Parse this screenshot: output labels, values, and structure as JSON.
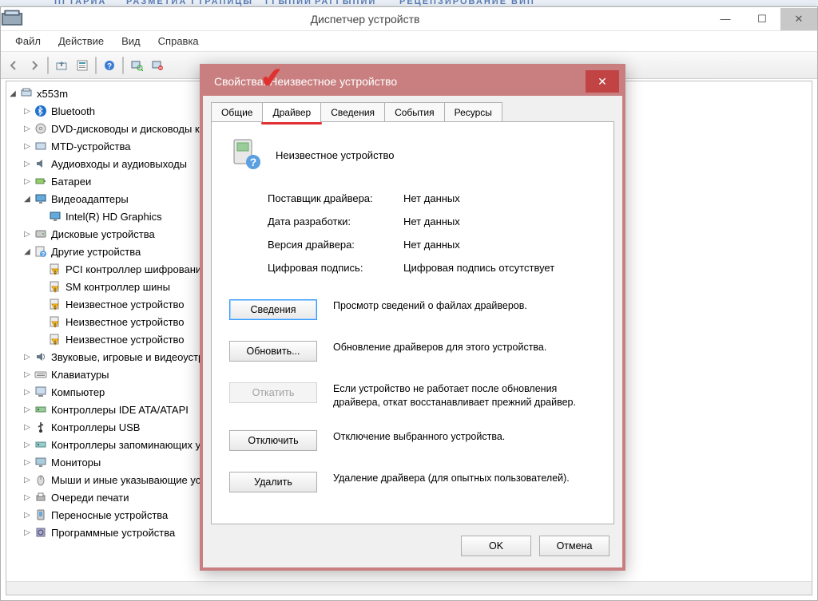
{
  "bg_labels": {
    "l1": "ПГТАРИА",
    "l2": "РАЗМЕТИА ГТРАПИЦЫ",
    "l3": "ГГЫПИИ",
    "l4": "РАГГЫПИИ",
    "l5": "РЕЦЕПЗИРОВАНИЕ",
    "l6": "ВИП"
  },
  "window": {
    "title": "Диспетчер устройств",
    "menu": {
      "file": "Файл",
      "action": "Действие",
      "view": "Вид",
      "help": "Справка"
    }
  },
  "tree": {
    "root": "x553m",
    "items": [
      {
        "label": "Bluetooth",
        "depth": 1,
        "exp": "closed",
        "icon": "bt"
      },
      {
        "label": "DVD-дисководы и дисководы компакт-дисков",
        "depth": 1,
        "exp": "closed",
        "icon": "dvd"
      },
      {
        "label": "MTD-устройства",
        "depth": 1,
        "exp": "closed",
        "icon": "mtd"
      },
      {
        "label": "Аудиовходы и аудиовыходы",
        "depth": 1,
        "exp": "closed",
        "icon": "audio"
      },
      {
        "label": "Батареи",
        "depth": 1,
        "exp": "closed",
        "icon": "bat"
      },
      {
        "label": "Видеоадаптеры",
        "depth": 1,
        "exp": "open",
        "icon": "disp"
      },
      {
        "label": "Intel(R) HD Graphics",
        "depth": 2,
        "exp": "none",
        "icon": "disp"
      },
      {
        "label": "Дисковые устройства",
        "depth": 1,
        "exp": "closed",
        "icon": "disk"
      },
      {
        "label": "Другие устройства",
        "depth": 1,
        "exp": "open",
        "icon": "other"
      },
      {
        "label": "PCI контроллер шифрования/расшифрования",
        "depth": 2,
        "exp": "none",
        "icon": "warn"
      },
      {
        "label": "SM контроллер шины",
        "depth": 2,
        "exp": "none",
        "icon": "warn"
      },
      {
        "label": "Неизвестное устройство",
        "depth": 2,
        "exp": "none",
        "icon": "warn"
      },
      {
        "label": "Неизвестное устройство",
        "depth": 2,
        "exp": "none",
        "icon": "warn"
      },
      {
        "label": "Неизвестное устройство",
        "depth": 2,
        "exp": "none",
        "icon": "warn"
      },
      {
        "label": "Звуковые, игровые и видеоустройства",
        "depth": 1,
        "exp": "closed",
        "icon": "sound"
      },
      {
        "label": "Клавиатуры",
        "depth": 1,
        "exp": "closed",
        "icon": "kbd"
      },
      {
        "label": "Компьютер",
        "depth": 1,
        "exp": "closed",
        "icon": "pc"
      },
      {
        "label": "Контроллеры IDE ATA/ATAPI",
        "depth": 1,
        "exp": "closed",
        "icon": "ide"
      },
      {
        "label": "Контроллеры USB",
        "depth": 1,
        "exp": "closed",
        "icon": "usb"
      },
      {
        "label": "Контроллеры запоминающих устройств",
        "depth": 1,
        "exp": "closed",
        "icon": "stor"
      },
      {
        "label": "Мониторы",
        "depth": 1,
        "exp": "closed",
        "icon": "mon"
      },
      {
        "label": "Мыши и иные указывающие устройства",
        "depth": 1,
        "exp": "closed",
        "icon": "mouse"
      },
      {
        "label": "Очереди печати",
        "depth": 1,
        "exp": "closed",
        "icon": "print"
      },
      {
        "label": "Переносные устройства",
        "depth": 1,
        "exp": "closed",
        "icon": "port"
      },
      {
        "label": "Программные устройства",
        "depth": 1,
        "exp": "closed",
        "icon": "soft"
      }
    ]
  },
  "dialog": {
    "title": "Свойства: Неизвестное устройство",
    "tabs": {
      "general": "Общие",
      "driver": "Драйвер",
      "details": "Сведения",
      "events": "События",
      "resources": "Ресурсы"
    },
    "device_name": "Неизвестное устройство",
    "fields": {
      "provider_label": "Поставщик драйвера:",
      "provider_val": "Нет данных",
      "date_label": "Дата разработки:",
      "date_val": "Нет данных",
      "version_label": "Версия драйвера:",
      "version_val": "Нет данных",
      "sig_label": "Цифровая подпись:",
      "sig_val": "Цифровая подпись отсутствует"
    },
    "buttons": {
      "details": {
        "label": "Сведения",
        "desc": "Просмотр сведений о файлах драйверов."
      },
      "update": {
        "label": "Обновить...",
        "desc": "Обновление драйверов для этого устройства."
      },
      "rollback": {
        "label": "Откатить",
        "desc": "Если устройство не работает после обновления драйвера, откат восстанавливает прежний драйвер."
      },
      "disable": {
        "label": "Отключить",
        "desc": "Отключение выбранного устройства."
      },
      "uninstall": {
        "label": "Удалить",
        "desc": "Удаление драйвера (для опытных пользователей)."
      }
    },
    "ok": "OK",
    "cancel": "Отмена"
  }
}
